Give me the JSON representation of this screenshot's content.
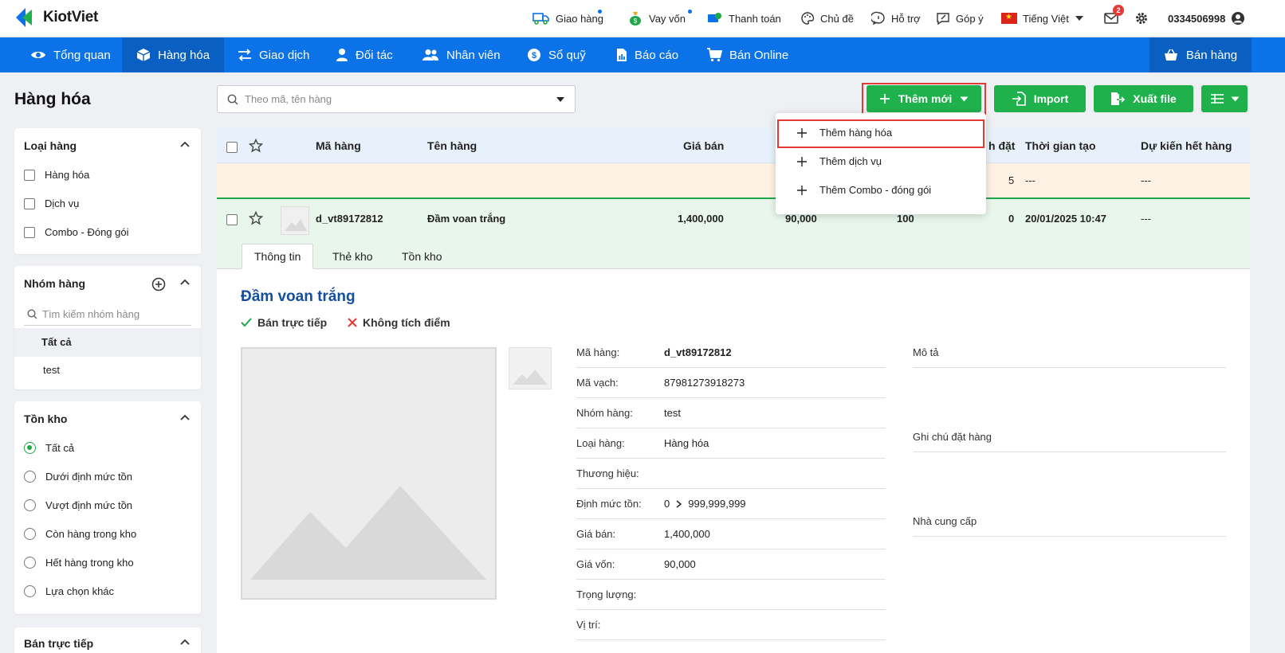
{
  "app": {
    "name": "KiotViet"
  },
  "topbar": {
    "items": [
      {
        "label": "Giao hàng",
        "icon": "delivery-truck-icon",
        "dot": true
      },
      {
        "label": "Vay vốn",
        "icon": "money-bag-icon",
        "dot": true
      },
      {
        "label": "Thanh toán",
        "icon": "payment-icon"
      },
      {
        "label": "Chủ đề",
        "icon": "palette-icon"
      },
      {
        "label": "Hỗ trợ",
        "icon": "chat-bubble-icon"
      },
      {
        "label": "Góp ý",
        "icon": "feedback-icon"
      }
    ],
    "language": "Tiếng Việt",
    "mail_badge": "2",
    "phone": "0334506998"
  },
  "nav": {
    "items": [
      {
        "label": "Tổng quan",
        "icon": "eye-icon"
      },
      {
        "label": "Hàng hóa",
        "icon": "box-icon",
        "active": true
      },
      {
        "label": "Giao dịch",
        "icon": "transfer-icon"
      },
      {
        "label": "Đối tác",
        "icon": "partner-icon"
      },
      {
        "label": "Nhân viên",
        "icon": "staff-icon"
      },
      {
        "label": "Sổ quỹ",
        "icon": "cash-book-icon"
      },
      {
        "label": "Báo cáo",
        "icon": "report-icon"
      },
      {
        "label": "Bán Online",
        "icon": "cart-icon"
      }
    ],
    "sell_label": "Bán hàng"
  },
  "page": {
    "title": "Hàng hóa"
  },
  "sidebar": {
    "product_type": {
      "title": "Loại hàng",
      "options": [
        "Hàng hóa",
        "Dịch vụ",
        "Combo - Đóng gói"
      ]
    },
    "product_group": {
      "title": "Nhóm hàng",
      "search_placeholder": "Tìm kiếm nhóm hàng",
      "items": [
        "Tất cả",
        "test"
      ],
      "selected": "Tất cả"
    },
    "stock": {
      "title": "Tồn kho",
      "options": [
        "Tất cả",
        "Dưới định mức tồn",
        "Vượt định mức tồn",
        "Còn hàng trong kho",
        "Hết hàng trong kho",
        "Lựa chọn khác"
      ],
      "selected": "Tất cả"
    },
    "direct_sale": {
      "title": "Bán trực tiếp"
    }
  },
  "toolbar": {
    "search_placeholder": "Theo mã, tên hàng",
    "add_new_label": "Thêm mới",
    "import_label": "Import",
    "export_label": "Xuất file"
  },
  "add_menu": {
    "items": [
      "Thêm hàng hóa",
      "Thêm dịch vụ",
      "Thêm Combo - đóng gói"
    ],
    "highlighted": "Thêm hàng hóa"
  },
  "table": {
    "headers": {
      "code": "Mã hàng",
      "name": "Tên hàng",
      "price": "Giá bán",
      "ordered": "h đặt",
      "created": "Thời gian tạo",
      "expected_out": "Dự kiến hết hàng"
    },
    "summary": {
      "ordered": "5",
      "created": "---",
      "expected_out": "---"
    },
    "rows": [
      {
        "code": "d_vt89172812",
        "name": "Đầm voan trắng",
        "price": "1,400,000",
        "cost": "90,000",
        "stock": "100",
        "ordered": "0",
        "created": "20/01/2025 10:47",
        "expected_out": "---"
      }
    ]
  },
  "detail": {
    "tabs": [
      "Thông tin",
      "Thẻ kho",
      "Tồn kho"
    ],
    "active_tab": "Thông tin",
    "title": "Đầm voan trắng",
    "flags": [
      {
        "label": "Bán trực tiếp",
        "state": "on",
        "color": "#1fa84a"
      },
      {
        "label": "Không tích điểm",
        "state": "off",
        "color": "#e53935"
      }
    ],
    "fields": [
      {
        "label": "Mã hàng:",
        "value": "d_vt89172812",
        "bold": true
      },
      {
        "label": "Mã vạch:",
        "value": "87981273918273"
      },
      {
        "label": "Nhóm hàng:",
        "value": "test"
      },
      {
        "label": "Loại hàng:",
        "value": "Hàng hóa"
      },
      {
        "label": "Thương hiệu:",
        "value": ""
      },
      {
        "label": "Định mức tồn:",
        "value_min": "0",
        "value_max": "999,999,999"
      },
      {
        "label": "Giá bán:",
        "value": "1,400,000"
      },
      {
        "label": "Giá vốn:",
        "value": "90,000"
      },
      {
        "label": "Trọng lượng:",
        "value": ""
      },
      {
        "label": "Vị trí:",
        "value": ""
      }
    ],
    "right_fields": [
      "Mô tả",
      "Ghi chú đặt hàng",
      "Nhà cung cấp"
    ]
  },
  "colors": {
    "brand_blue": "#0b72e7",
    "green": "#1fb14b",
    "highlight_red": "#e53935"
  }
}
